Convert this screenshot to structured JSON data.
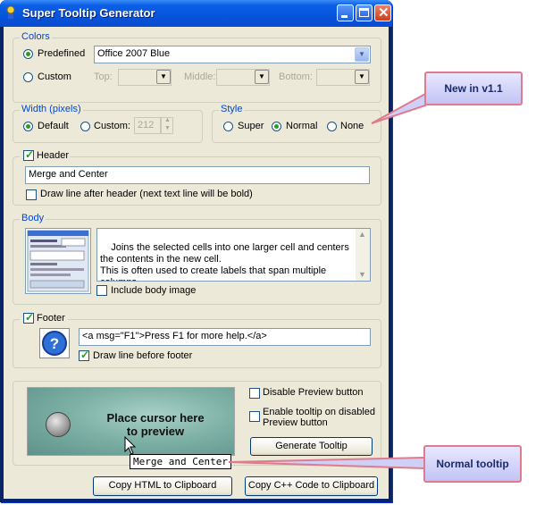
{
  "window": {
    "title": "Super Tooltip Generator"
  },
  "colors": {
    "group_label": "Colors",
    "predefined_label": "Predefined",
    "predefined_value": "Office 2007 Blue",
    "custom_label": "Custom",
    "top_label": "Top:",
    "middle_label": "Middle:",
    "bottom_label": "Bottom:"
  },
  "width": {
    "group_label": "Width (pixels)",
    "default_label": "Default",
    "custom_label": "Custom:",
    "custom_value": "212"
  },
  "style": {
    "group_label": "Style",
    "options": [
      "Super",
      "Normal",
      "None"
    ],
    "selected": "Normal"
  },
  "header": {
    "checkbox_label": "Header",
    "text_value": "Merge and Center",
    "draw_line_label": "Draw line after header (next text line will be bold)"
  },
  "body": {
    "group_label": "Body",
    "text": "Joins the selected cells into one larger cell and centers the contents in the new cell.\nThis is often used to create labels that span multiple columns.",
    "include_image_label": "Include body image"
  },
  "footer": {
    "checkbox_label": "Footer",
    "text_value": "<a msg=\"F1\">Press F1 for more help.</a>",
    "draw_line_label": "Draw line before footer"
  },
  "preview": {
    "text_line1": "Place cursor here",
    "text_line2": "to preview",
    "tooltip_text": "Merge and Center"
  },
  "options": {
    "disable_preview_label": "Disable Preview button",
    "enable_tooltip_label": "Enable tooltip on disabled Preview button",
    "generate_label": "Generate Tooltip"
  },
  "buttons": {
    "copy_html": "Copy HTML to Clipboard",
    "copy_cpp": "Copy C++ Code to Clipboard"
  },
  "callouts": {
    "new_in": "New in v1.1",
    "normal_tooltip": "Normal tooltip"
  },
  "colors_hex": {
    "accent": "#0a5fe6",
    "group_label": "#0046d5",
    "callout_border": "#e07a8e"
  }
}
